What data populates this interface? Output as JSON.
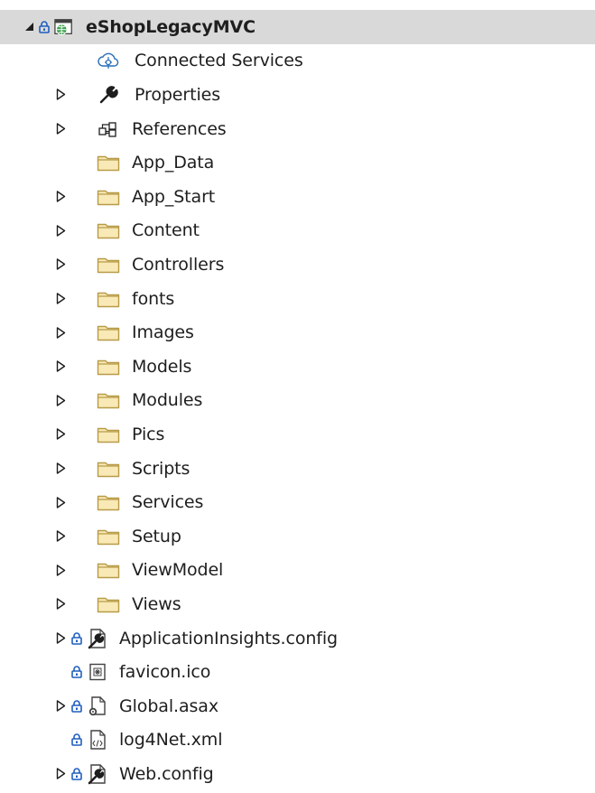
{
  "solution_explorer": {
    "project": {
      "label": "eShopLegacyMVC",
      "expanded": true,
      "locked": true,
      "icon": "web-project-icon",
      "selected": true
    },
    "items": [
      {
        "label": "Connected Services",
        "icon": "connected-services-icon",
        "expandable": false,
        "locked": false
      },
      {
        "label": "Properties",
        "icon": "wrench-icon",
        "expandable": true,
        "locked": false
      },
      {
        "label": "References",
        "icon": "references-icon",
        "expandable": true,
        "locked": false
      },
      {
        "label": "App_Data",
        "icon": "folder-icon",
        "expandable": false,
        "locked": false
      },
      {
        "label": "App_Start",
        "icon": "folder-icon",
        "expandable": true,
        "locked": false
      },
      {
        "label": "Content",
        "icon": "folder-icon",
        "expandable": true,
        "locked": false
      },
      {
        "label": "Controllers",
        "icon": "folder-icon",
        "expandable": true,
        "locked": false
      },
      {
        "label": "fonts",
        "icon": "folder-icon",
        "expandable": true,
        "locked": false
      },
      {
        "label": "Images",
        "icon": "folder-icon",
        "expandable": true,
        "locked": false
      },
      {
        "label": "Models",
        "icon": "folder-icon",
        "expandable": true,
        "locked": false
      },
      {
        "label": "Modules",
        "icon": "folder-icon",
        "expandable": true,
        "locked": false
      },
      {
        "label": "Pics",
        "icon": "folder-icon",
        "expandable": true,
        "locked": false
      },
      {
        "label": "Scripts",
        "icon": "folder-icon",
        "expandable": true,
        "locked": false
      },
      {
        "label": "Services",
        "icon": "folder-icon",
        "expandable": true,
        "locked": false
      },
      {
        "label": "Setup",
        "icon": "folder-icon",
        "expandable": true,
        "locked": false
      },
      {
        "label": "ViewModel",
        "icon": "folder-icon",
        "expandable": true,
        "locked": false
      },
      {
        "label": "Views",
        "icon": "folder-icon",
        "expandable": true,
        "locked": false
      },
      {
        "label": "ApplicationInsights.config",
        "icon": "config-file-icon",
        "expandable": true,
        "locked": true
      },
      {
        "label": "favicon.ico",
        "icon": "icon-file-icon",
        "expandable": false,
        "locked": true
      },
      {
        "label": "Global.asax",
        "icon": "asax-file-icon",
        "expandable": true,
        "locked": true
      },
      {
        "label": "log4Net.xml",
        "icon": "xml-file-icon",
        "expandable": false,
        "locked": true
      },
      {
        "label": "Web.config",
        "icon": "config-file-icon",
        "expandable": true,
        "locked": true
      }
    ],
    "colors": {
      "selected_row": "#d9d9d9",
      "folder_fill": "#f8e9b6",
      "folder_stroke": "#b89b48",
      "lock": "#1f5fbf",
      "web_globe": "#3aa04a",
      "text": "#1e1e1e"
    }
  }
}
